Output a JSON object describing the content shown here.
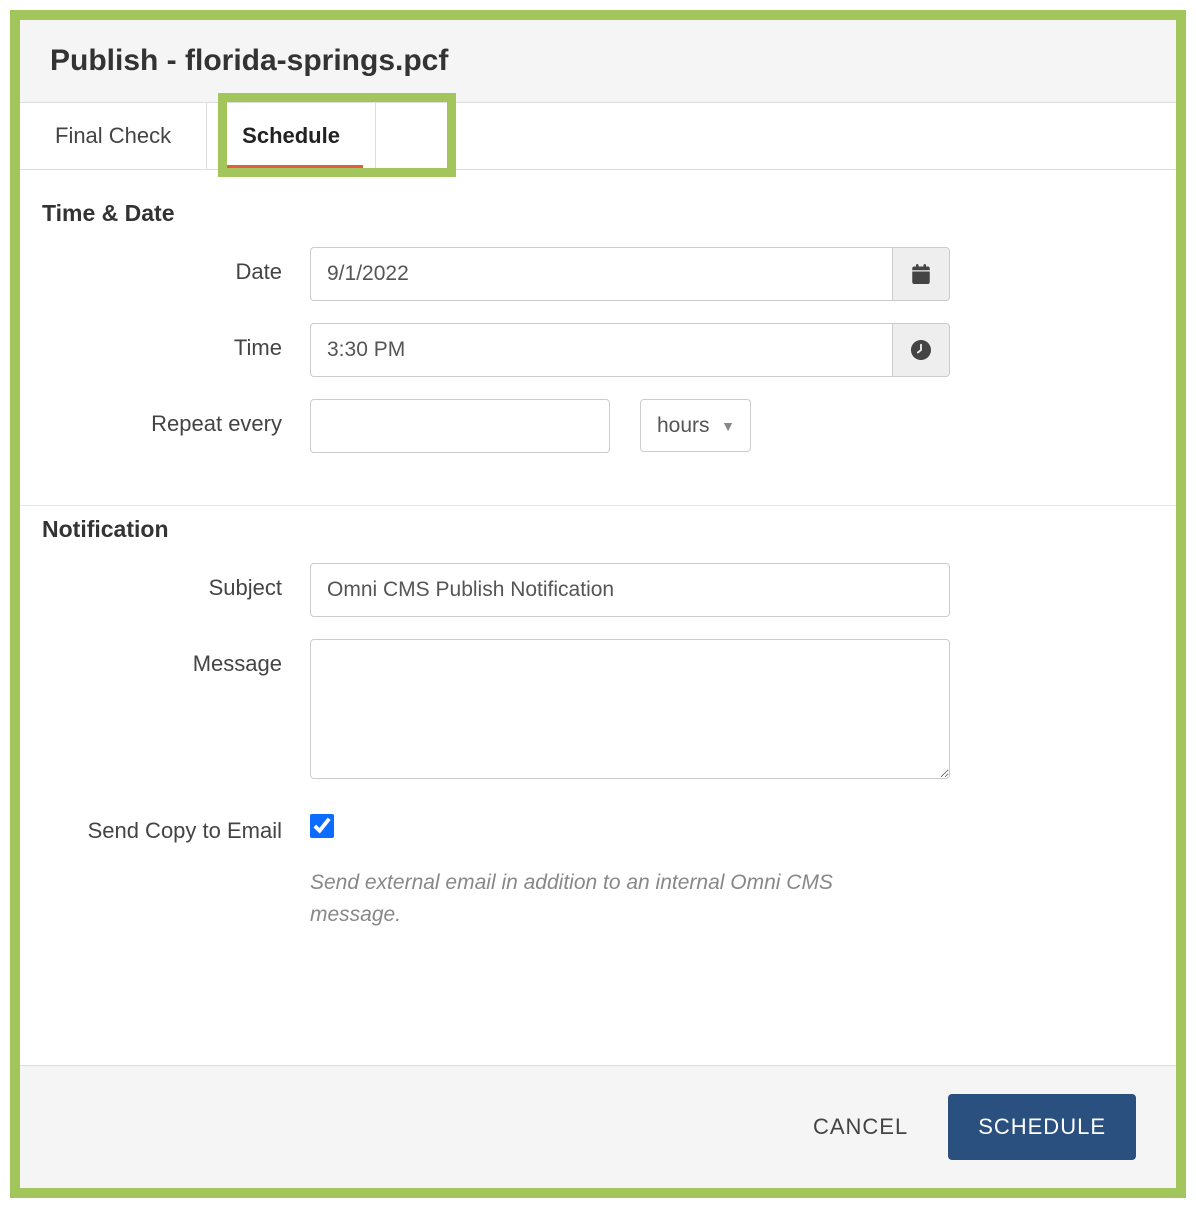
{
  "dialog": {
    "title": "Publish - florida-springs.pcf"
  },
  "tabs": {
    "final_check": "Final Check",
    "schedule": "Schedule"
  },
  "time_date": {
    "section_title": "Time & Date",
    "date_label": "Date",
    "date_value": "9/1/2022",
    "time_label": "Time",
    "time_value": "3:30 PM",
    "repeat_label": "Repeat every",
    "repeat_value": "",
    "repeat_unit": "hours"
  },
  "notification": {
    "section_title": "Notification",
    "subject_label": "Subject",
    "subject_value": "Omni CMS Publish Notification",
    "message_label": "Message",
    "message_value": "",
    "send_copy_label": "Send Copy to Email",
    "send_copy_checked": true,
    "send_copy_help": "Send external email in addition to an internal Omni CMS message."
  },
  "footer": {
    "cancel": "CANCEL",
    "schedule": "SCHEDULE"
  }
}
